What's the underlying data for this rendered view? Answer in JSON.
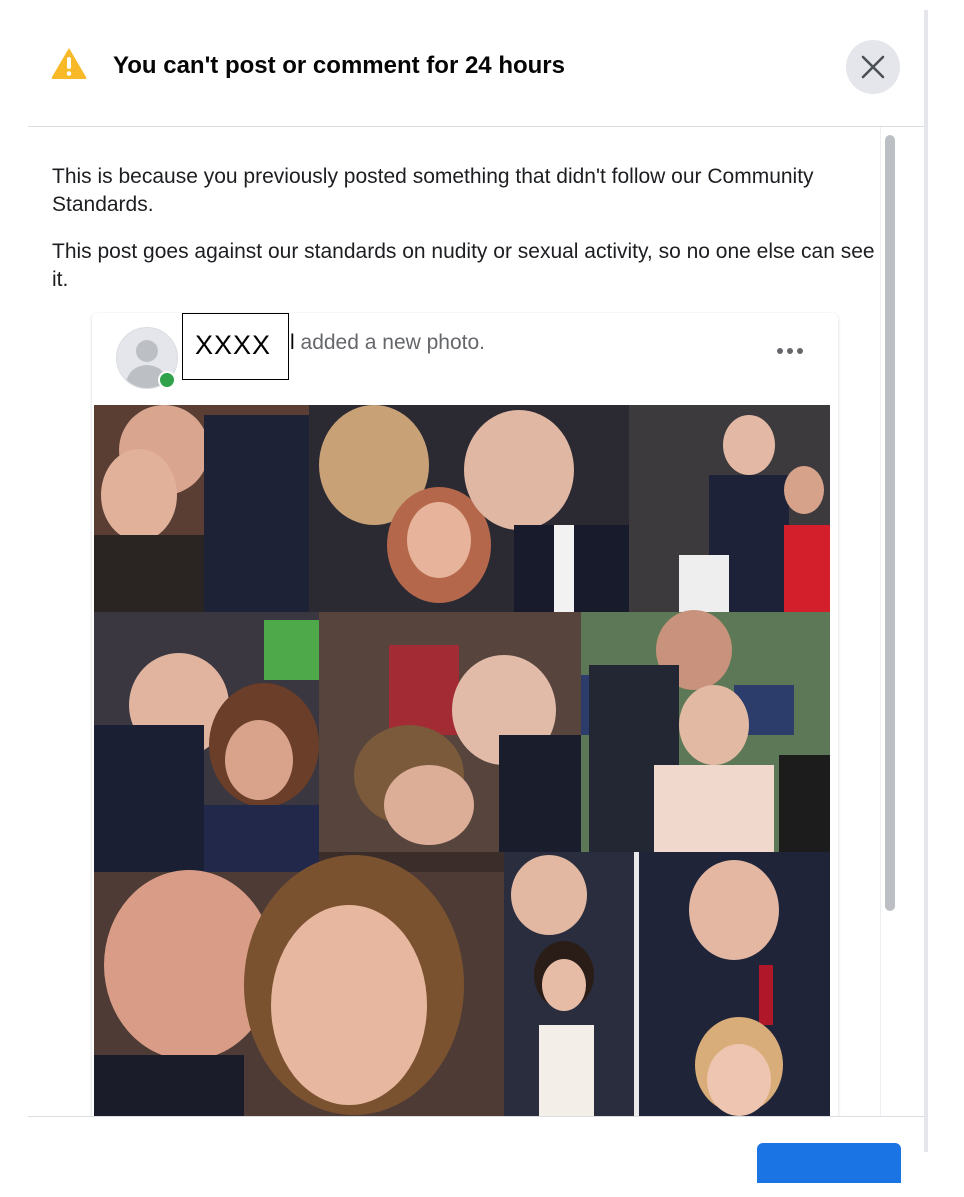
{
  "dialog": {
    "title": "You can't post or comment for 24 hours",
    "warning_icon": "warning-triangle-icon",
    "close_icon": "close-icon",
    "accent_color": "#1b74e4",
    "warning_color": "#f7b928"
  },
  "content": {
    "paragraph_1": "This is because you previously posted something that didn't follow our Community Standards.",
    "paragraph_2": "This post goes against our standards on nudity or sexual activity, so no one else can see it."
  },
  "post": {
    "author_name": "XXXX",
    "author_fragment": "l",
    "action_text": "added a new photo.",
    "avatar_icon": "default-avatar-icon",
    "status": "online",
    "status_color": "#31a24c",
    "more_icon": "more-options-icon"
  }
}
